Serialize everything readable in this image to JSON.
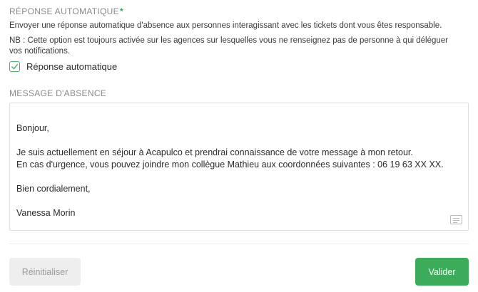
{
  "auto_reply": {
    "title": "RÉPONSE AUTOMATIQUE",
    "required_mark": "*",
    "description": "Envoyer une réponse automatique d'absence aux personnes interagissant avec les tickets dont vous êtes responsable.",
    "note": "NB : Cette option est toujours activée sur les agences sur lesquelles vous ne renseignez pas de personne à qui déléguer vos notifications.",
    "checkbox_label": "Réponse automatique",
    "checked": true
  },
  "absence_message": {
    "title": "MESSAGE D'ABSENCE",
    "value": "Bonjour,\n\nJe suis actuellement en séjour à Acapulco et prendrai connaissance de votre message à mon retour.\nEn cas d'urgence, vous pouvez joindre mon collègue Mathieu aux coordonnées suivantes : 06 19 63 XX XX.\n\nBien cordialement,\n\nVanessa Morin"
  },
  "actions": {
    "reset_label": "Réinitialiser",
    "submit_label": "Valider"
  },
  "icons": {
    "checkbox": "check-icon",
    "textarea": "text-format-icon"
  },
  "colors": {
    "accent": "#3cab5a",
    "label": "#8a8a8a"
  }
}
